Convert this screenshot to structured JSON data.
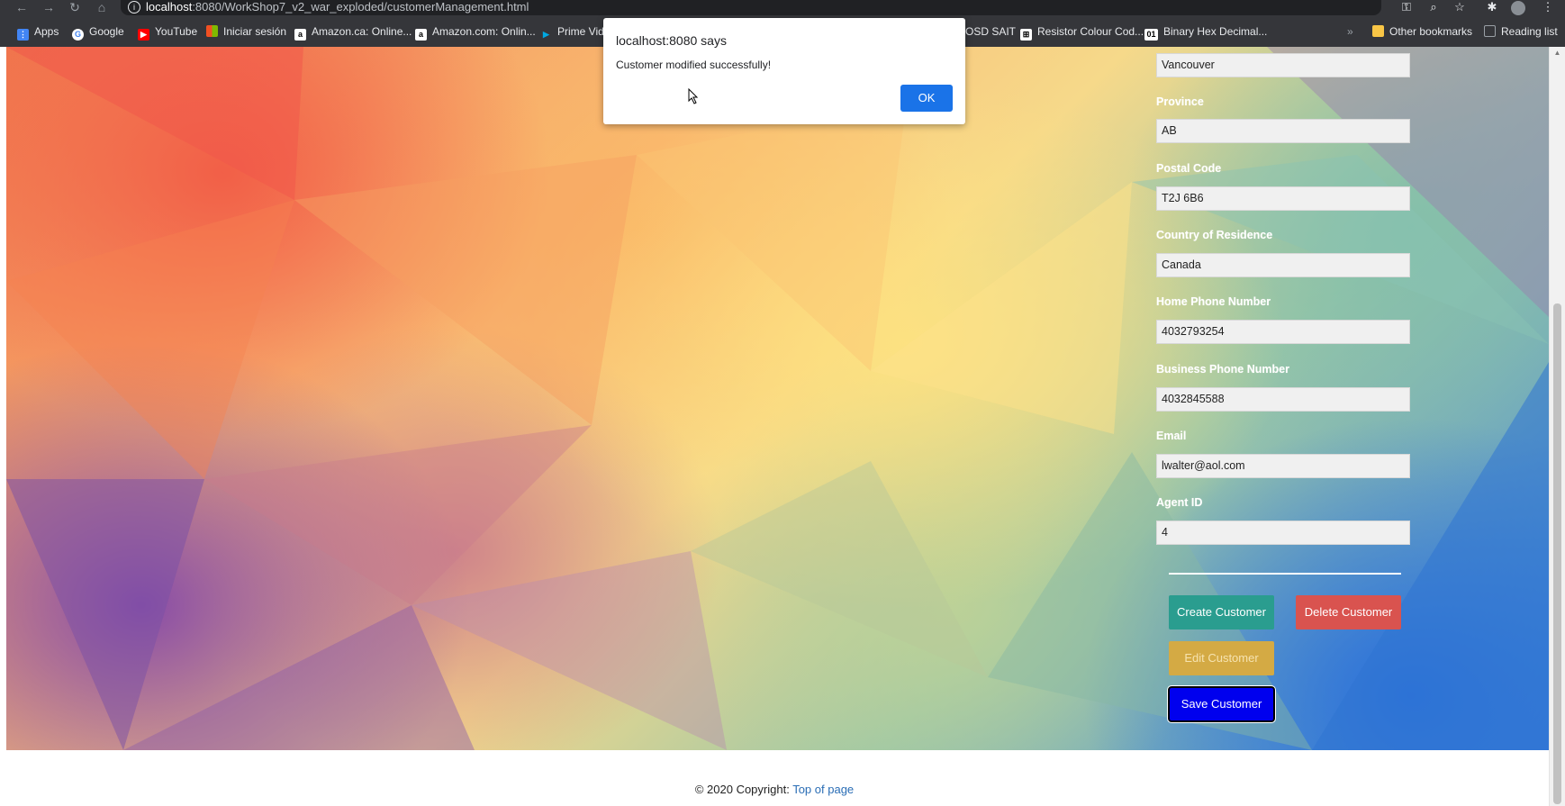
{
  "browser": {
    "url_host": "localhost",
    "url_rest": ":8080/WorkShop7_v2_war_exploded/customerManagement.html",
    "bookmarks": [
      {
        "label": "Apps",
        "icon": "apps-grid-icon",
        "color": "#ea4335"
      },
      {
        "label": "Google",
        "icon": "google-icon",
        "color": "#4285f4"
      },
      {
        "label": "YouTube",
        "icon": "youtube-icon",
        "color": "#ff0000"
      },
      {
        "label": "Iniciar sesión",
        "icon": "microsoft-icon",
        "color": "#f25022"
      },
      {
        "label": "Amazon.ca: Online...",
        "icon": "amazon-icon",
        "color": "#ffffff"
      },
      {
        "label": "Amazon.com: Onlin...",
        "icon": "amazon-icon",
        "color": "#ffffff"
      },
      {
        "label": "Prime Vide",
        "icon": "prime-video-icon",
        "color": "#00a8e1"
      },
      {
        "label": "OSD SAIT",
        "icon": "",
        "color": ""
      },
      {
        "label": "Resistor Colour Cod...",
        "icon": "resistor-icon",
        "color": "#ffffff"
      },
      {
        "label": "Binary Hex Decimal...",
        "icon": "binary-icon",
        "color": "#ffffff"
      },
      {
        "label": "»",
        "icon": "",
        "color": ""
      },
      {
        "label": "Other bookmarks",
        "icon": "folder-icon",
        "color": "#f9c646"
      },
      {
        "label": "Reading list",
        "icon": "reading-list-icon",
        "color": "#9aa0a6"
      }
    ]
  },
  "form": {
    "city_value": "Vancouver",
    "province_label": "Province",
    "province_value": "AB",
    "postal_label": "Postal Code",
    "postal_value": "T2J 6B6",
    "country_label": "Country of Residence",
    "country_value": "Canada",
    "home_phone_label": "Home Phone Number",
    "home_phone_value": "4032793254",
    "business_phone_label": "Business Phone Number",
    "business_phone_value": "4032845588",
    "email_label": "Email",
    "email_value": "lwalter@aol.com",
    "agent_label": "Agent ID",
    "agent_value": "4"
  },
  "buttons": {
    "create": "Create Customer",
    "delete": "Delete Customer",
    "edit": "Edit Customer",
    "save": "Save Customer"
  },
  "footer": {
    "copyright": "© 2020 Copyright: ",
    "link": "Top of page"
  },
  "dialog": {
    "title": "localhost:8080 says",
    "message": "Customer modified successfully!",
    "ok": "OK"
  },
  "colors": {
    "accent": "#1a73e8",
    "create": "#2a9d8f",
    "delete": "#d9534f",
    "edit": "#d4aa44",
    "save": "#0000ee"
  }
}
